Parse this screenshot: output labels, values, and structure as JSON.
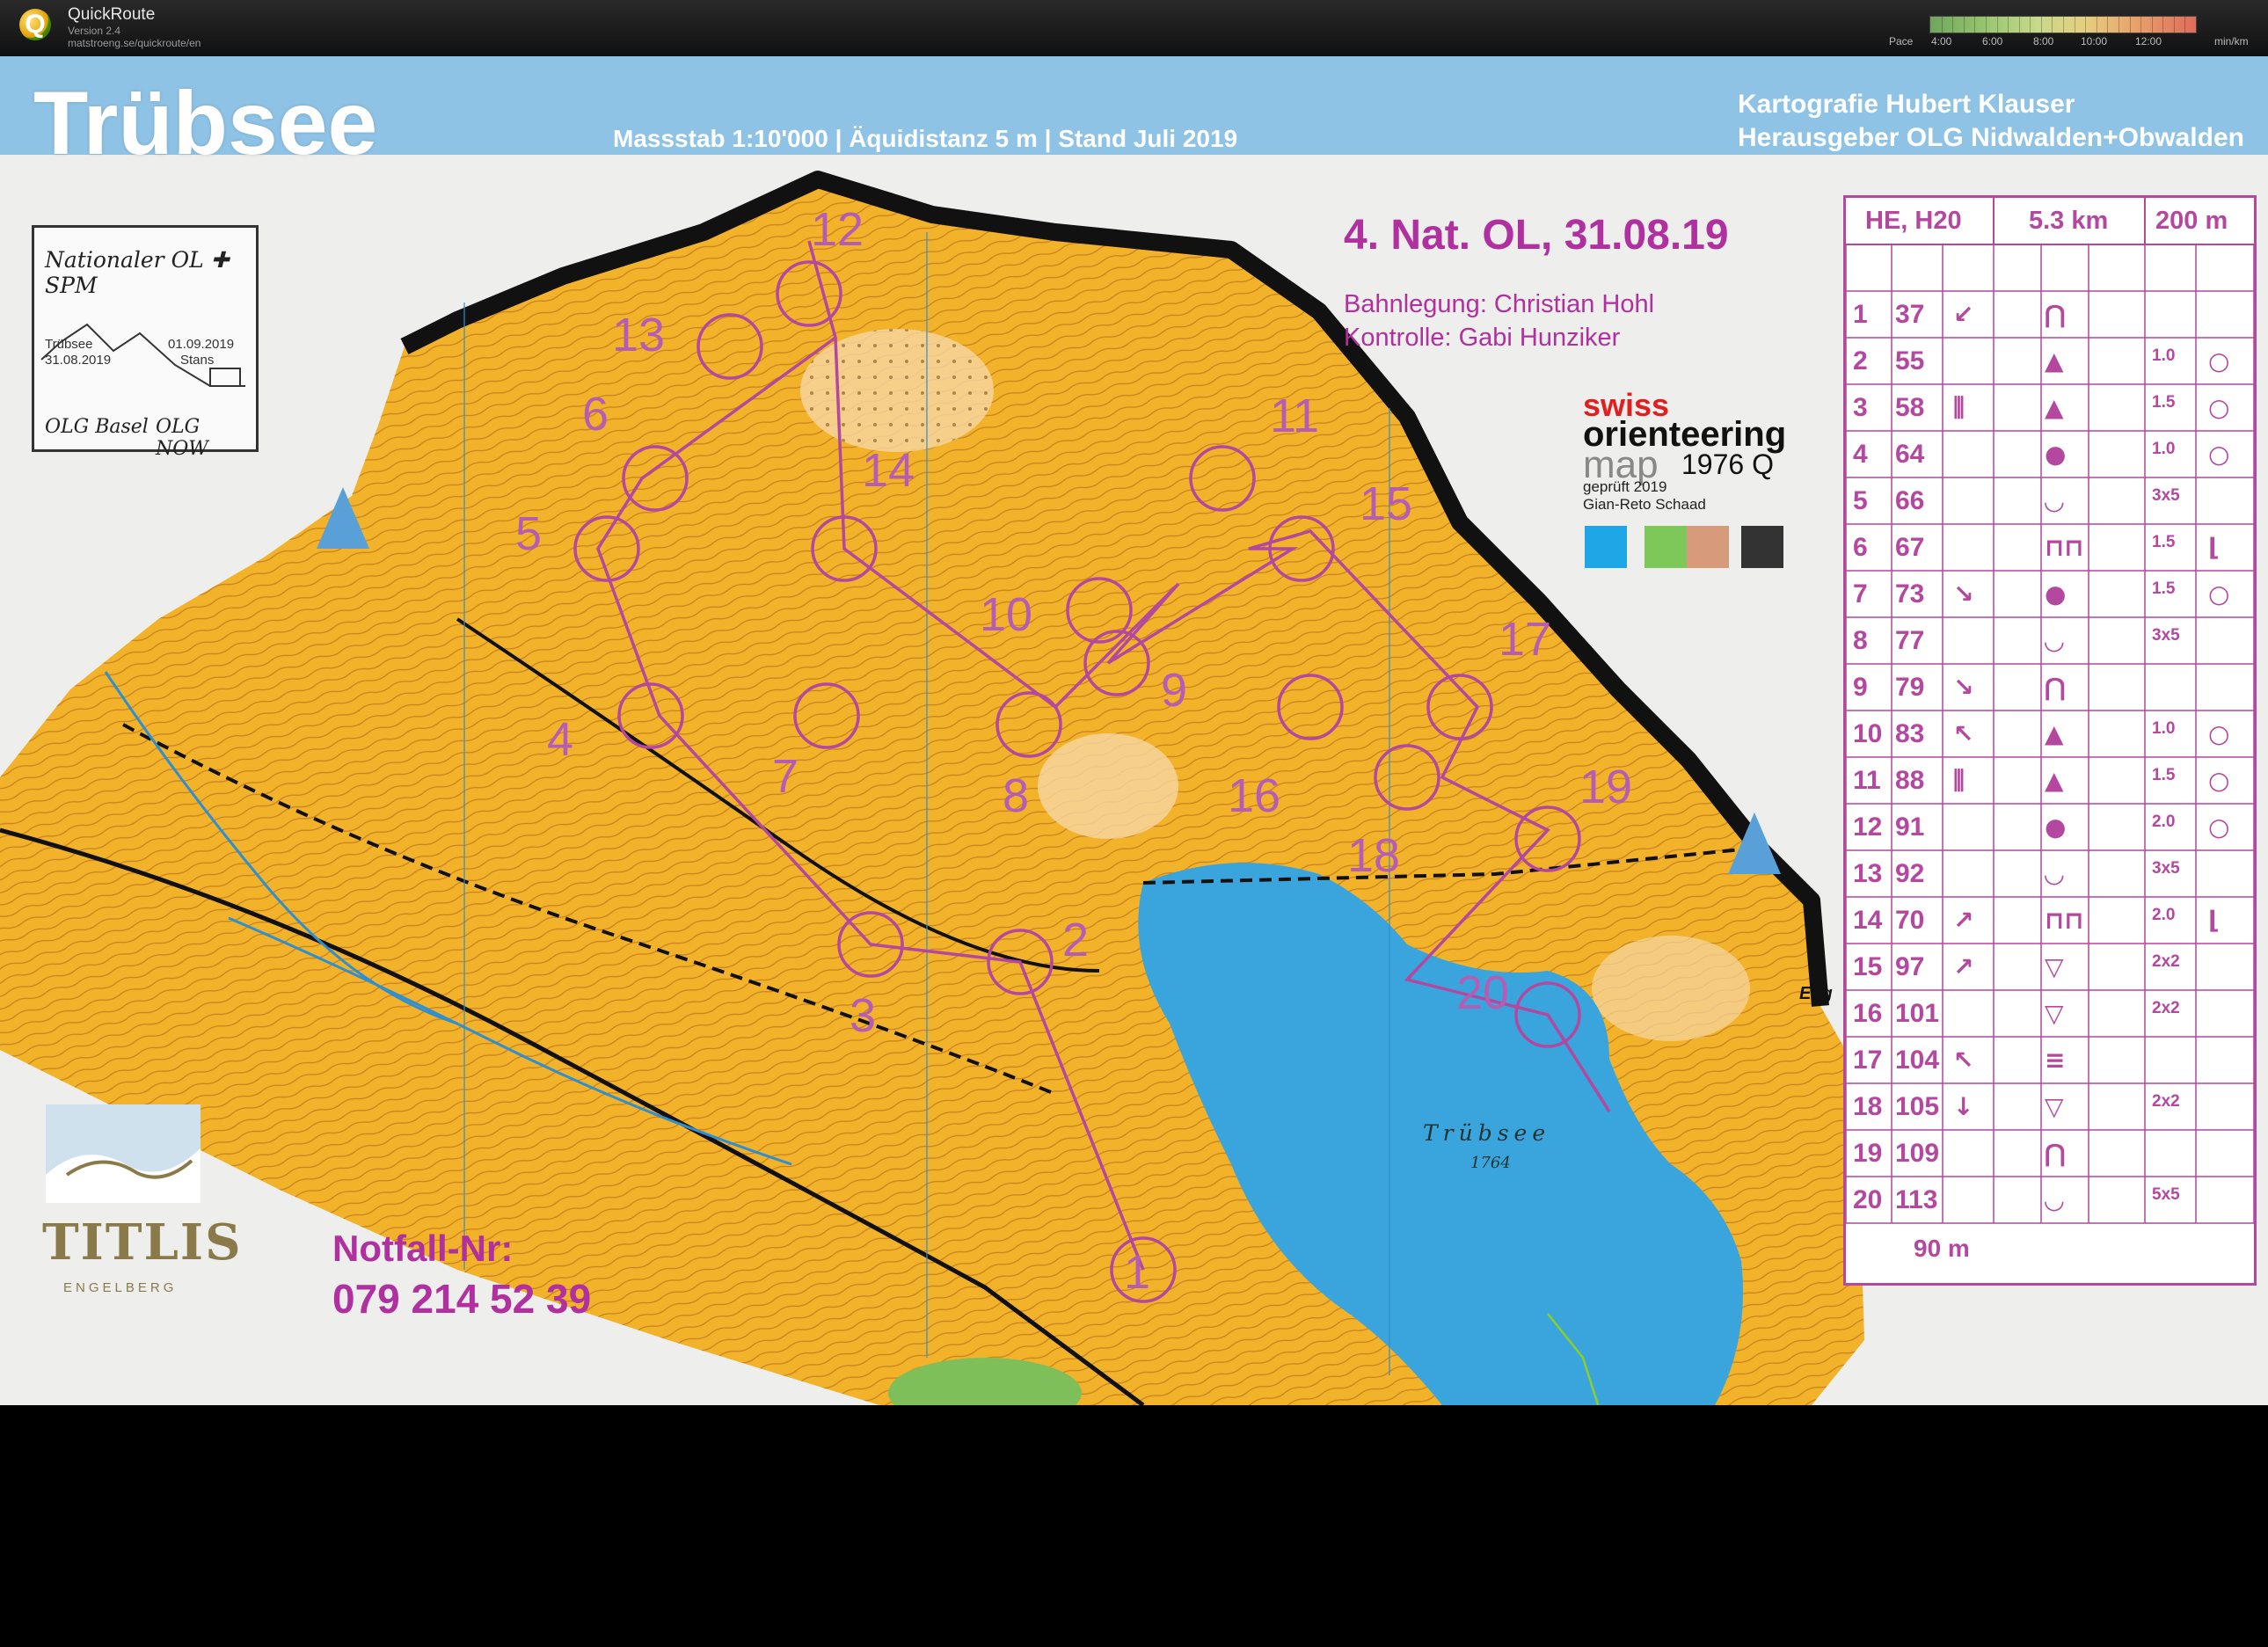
{
  "app": {
    "title": "QuickRoute",
    "version": "Version 2.4",
    "url": "matstroeng.se/quickroute/en",
    "pace_label": "Pace",
    "pace_ticks": [
      "4:00",
      "6:00",
      "8:00",
      "10:00",
      "12:00"
    ],
    "pace_unit": "min/km"
  },
  "map": {
    "title": "Trübsee",
    "scale_text": "Massstab 1:10'000 | Äquidistanz 5 m | Stand Juli 2019",
    "cartographer": "Kartografie Hubert Klauser",
    "publisher": "Herausgeber OLG Nidwalden+Obwalden",
    "event_title": "4. Nat. OL, 31.08.19",
    "course_setter": "Bahnlegung: Christian Hohl",
    "controller": "Kontrolle: Gabi Hunziker",
    "emergency_label": "Notfall-Nr:",
    "emergency_number": "079 214 52 39",
    "lake_name": "Trübsee",
    "lake_elevation": "1764",
    "eng_label": "Eng",
    "inset": {
      "title": "Nationaler OL ✚ SPM",
      "place1": "Trübsee",
      "date1": "31.08.2019",
      "date2": "01.09.2019",
      "place2": "Stans",
      "club1": "OLG Basel",
      "club2": "OLG NOW"
    },
    "logo_so": {
      "line1": "swiss",
      "line2": "orienteering",
      "line3": "map",
      "code": "1976 Q",
      "checked": "geprüft 2019",
      "checker": "Gian-Reto Schaad"
    },
    "titlis": {
      "word": "TITLIS",
      "sub": "ENGELBERG"
    },
    "control_numbers": [
      {
        "n": "1"
      },
      {
        "n": "2"
      },
      {
        "n": "3"
      },
      {
        "n": "4"
      },
      {
        "n": "5"
      },
      {
        "n": "6"
      },
      {
        "n": "7"
      },
      {
        "n": "8"
      },
      {
        "n": "9"
      },
      {
        "n": "10"
      },
      {
        "n": "11"
      },
      {
        "n": "12"
      },
      {
        "n": "13"
      },
      {
        "n": "14"
      },
      {
        "n": "15"
      },
      {
        "n": "16"
      },
      {
        "n": "17"
      },
      {
        "n": "18"
      },
      {
        "n": "19"
      },
      {
        "n": "20"
      }
    ],
    "colors": {
      "map_yellow": "#f2b22a",
      "lake_blue": "#3aa5dc",
      "banner_blue": "#8fc3e6",
      "course_purple": "#b4479e"
    }
  },
  "description_table": {
    "class": "HE, H20",
    "length": "5.3 km",
    "climb": "200 m",
    "rows": [
      {
        "num": "1",
        "code": "37",
        "dir": "↙",
        "feature": "⋂",
        "dim": "",
        "loc": ""
      },
      {
        "num": "2",
        "code": "55",
        "dir": "",
        "feature": "▲",
        "dim": "1.0",
        "loc": "○"
      },
      {
        "num": "3",
        "code": "58",
        "dir": "⫼",
        "feature": "▲",
        "dim": "1.5",
        "loc": "○"
      },
      {
        "num": "4",
        "code": "64",
        "dir": "",
        "feature": "●",
        "dim": "1.0",
        "loc": "○"
      },
      {
        "num": "5",
        "code": "66",
        "dir": "",
        "feature": "◡",
        "dim": "3x5",
        "loc": ""
      },
      {
        "num": "6",
        "code": "67",
        "dir": "",
        "feature": "⊓⊓",
        "dim": "1.5",
        "loc": "⌊"
      },
      {
        "num": "7",
        "code": "73",
        "dir": "↘",
        "feature": "●",
        "dim": "1.5",
        "loc": "○"
      },
      {
        "num": "8",
        "code": "77",
        "dir": "",
        "feature": "◡",
        "dim": "3x5",
        "loc": ""
      },
      {
        "num": "9",
        "code": "79",
        "dir": "↘",
        "feature": "⋂",
        "dim": "",
        "loc": ""
      },
      {
        "num": "10",
        "code": "83",
        "dir": "↖",
        "feature": "▲",
        "dim": "1.0",
        "loc": "○"
      },
      {
        "num": "11",
        "code": "88",
        "dir": "⫼",
        "feature": "▲",
        "dim": "1.5",
        "loc": "○"
      },
      {
        "num": "12",
        "code": "91",
        "dir": "",
        "feature": "●",
        "dim": "2.0",
        "loc": "○"
      },
      {
        "num": "13",
        "code": "92",
        "dir": "",
        "feature": "◡",
        "dim": "3x5",
        "loc": ""
      },
      {
        "num": "14",
        "code": "70",
        "dir": "↗",
        "feature": "⊓⊓",
        "dim": "2.0",
        "loc": "⌊"
      },
      {
        "num": "15",
        "code": "97",
        "dir": "↗",
        "feature": "▽",
        "dim": "2x2",
        "loc": ""
      },
      {
        "num": "16",
        "code": "101",
        "dir": "",
        "feature": "▽",
        "dim": "2x2",
        "loc": ""
      },
      {
        "num": "17",
        "code": "104",
        "dir": "↖",
        "feature": "≡",
        "dim": "",
        "loc": ""
      },
      {
        "num": "18",
        "code": "105",
        "dir": "↓",
        "feature": "▽",
        "dim": "2x2",
        "loc": ""
      },
      {
        "num": "19",
        "code": "109",
        "dir": "",
        "feature": "⋂",
        "dim": "",
        "loc": ""
      },
      {
        "num": "20",
        "code": "113",
        "dir": "",
        "feature": "◡",
        "dim": "5x5",
        "loc": ""
      }
    ],
    "legend": "90 m"
  }
}
